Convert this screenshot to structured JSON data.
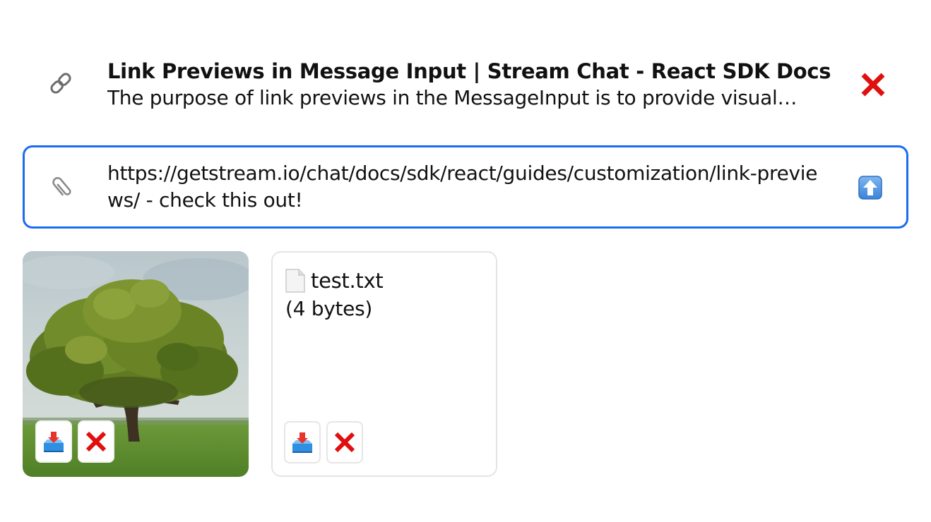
{
  "link_preview": {
    "title": "Link Previews in Message Input | Stream Chat - React SDK Docs",
    "description": "The purpose of link previews in the MessageInput is to provide visual…",
    "icon": "link-icon",
    "dismiss_icon": "close-x-icon"
  },
  "composer": {
    "text": "https://getstream.io/chat/docs/sdk/react/guides/customization/link-previews/ - check this out!",
    "attach_icon": "paperclip-icon",
    "send_icon": "up-arrow-icon",
    "border_color": "#1a6cf2"
  },
  "attachments": [
    {
      "kind": "image",
      "image_icon": "tree-image",
      "download_icon": "download-tray-icon",
      "remove_icon": "close-x-icon"
    },
    {
      "kind": "file",
      "file_icon": "document-icon",
      "name": "test.txt",
      "size": "(4 bytes)",
      "download_icon": "download-tray-icon",
      "remove_icon": "close-x-icon"
    }
  ],
  "colors": {
    "accent": "#1a6cf2",
    "remove_red": "#e0100f",
    "download_blue": "#2f8fe0"
  }
}
